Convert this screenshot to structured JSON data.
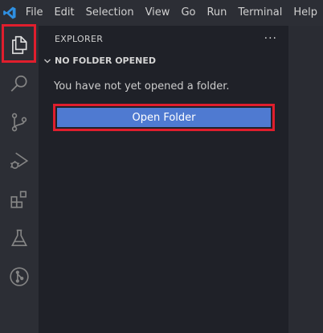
{
  "menubar": {
    "items": [
      "File",
      "Edit",
      "Selection",
      "View",
      "Go",
      "Run",
      "Terminal",
      "Help"
    ]
  },
  "activity_bar": {
    "icons": [
      "explorer-icon",
      "search-icon",
      "source-control-icon",
      "run-debug-icon",
      "extensions-icon",
      "testing-icon",
      "git-graph-icon"
    ]
  },
  "sidebar": {
    "title": "EXPLORER",
    "more_label": "···",
    "section_title": "NO FOLDER OPENED",
    "empty_message": "You have not yet opened a folder.",
    "open_folder_label": "Open Folder"
  },
  "colors": {
    "accent_blue": "#4f7ad1",
    "highlight_red": "#e01e2d",
    "logo_blue": "#2f8fe0"
  }
}
